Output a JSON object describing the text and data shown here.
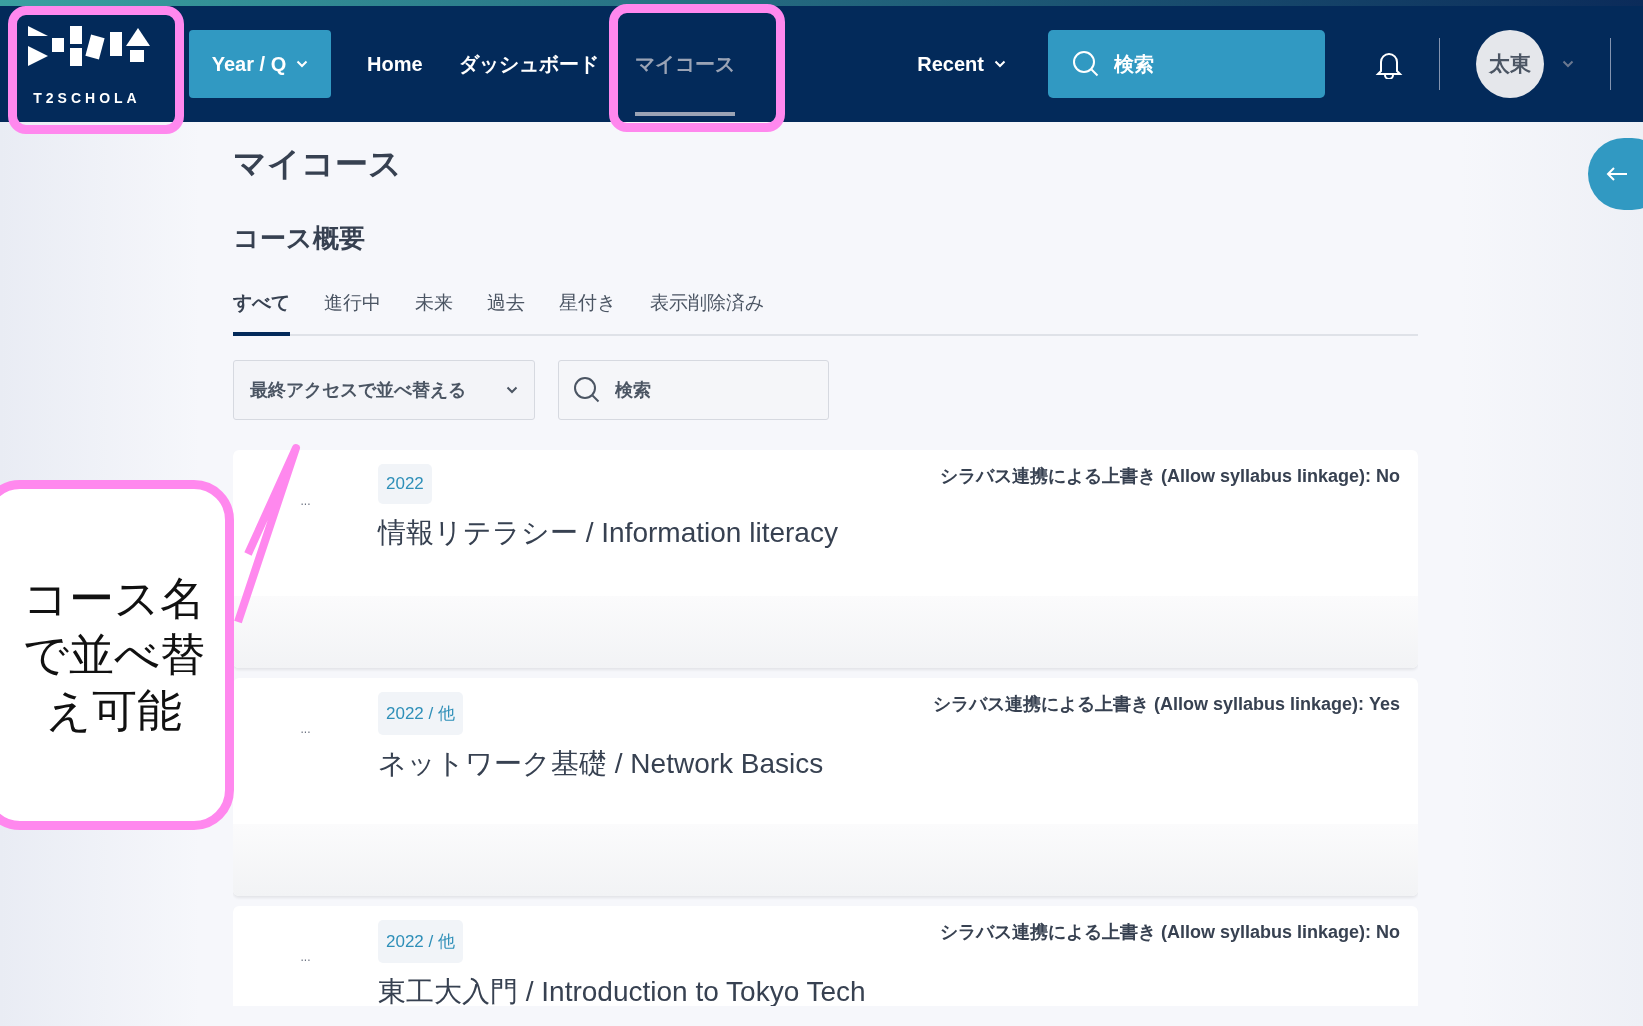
{
  "header": {
    "logo": {
      "text": "T2SCHOLA",
      "highlighted": true
    },
    "year_button": "Year / Q",
    "nav": [
      {
        "label": "Home",
        "selected": false,
        "highlighted": false
      },
      {
        "label": "ダッシュボード",
        "selected": false,
        "highlighted": false
      },
      {
        "label": "マイコース",
        "selected": true,
        "highlighted": true
      }
    ],
    "recent": "Recent",
    "search": {
      "placeholder": "検索"
    },
    "avatar": "太東"
  },
  "page_title": "マイコース",
  "section_title": "コース概要",
  "tabs": [
    {
      "label": "すべて",
      "selected": true
    },
    {
      "label": "進行中",
      "selected": false
    },
    {
      "label": "未来",
      "selected": false
    },
    {
      "label": "過去",
      "selected": false
    },
    {
      "label": "星付き",
      "selected": false
    },
    {
      "label": "表示削除済み",
      "selected": false
    }
  ],
  "sort": "最終アクセスで並べ替える",
  "course_search": {
    "placeholder": "検索"
  },
  "courses": [
    {
      "more": "...",
      "term": "2022",
      "name": "情報リテラシー / Information literacy",
      "syllabus": "シラバス連携による上書き (Allow syllabus linkage): No"
    },
    {
      "more": "...",
      "term": "2022 / 他",
      "name": "ネットワーク基礎 / Network Basics",
      "syllabus": "シラバス連携による上書き (Allow syllabus linkage): Yes"
    },
    {
      "more": "...",
      "term": "2022 / 他",
      "name": "東工大入門 / Introduction to Tokyo Tech",
      "syllabus": "シラバス連携による上書き (Allow syllabus linkage): No"
    }
  ],
  "callout": "コース名で並べ替え可能"
}
